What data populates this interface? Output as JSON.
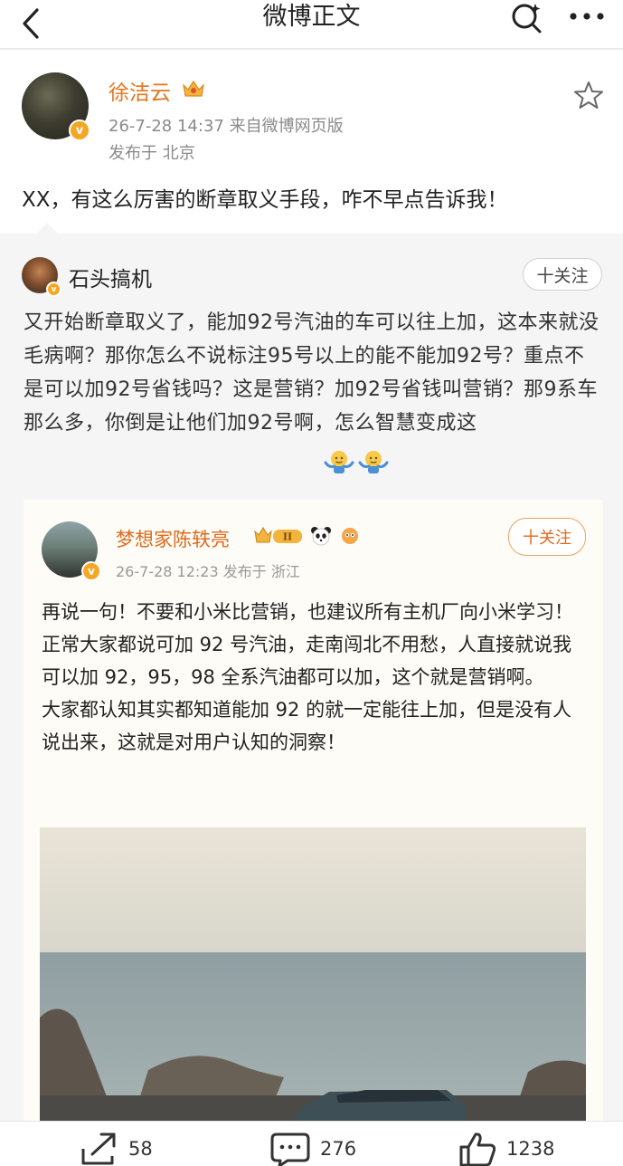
{
  "nav": {
    "title": "微博正文"
  },
  "post": {
    "author": "徐洁云",
    "time_source": "26-7-28 14:37  来自微博网页版",
    "location": "发布于 北京",
    "text": "XX，有这么厉害的断章取义手段，咋不早点告诉我！",
    "verified_badge": "v"
  },
  "repost": {
    "author": "石头搞机",
    "follow_label": "十关注",
    "text": "又开始断章取义了，能加92号汽油的车可以往上加，这本来就没毛病啊？那你怎么不说标注95号以上的能不能加92号？重点不是可以加92号省钱吗？这是营销？加92号省钱叫营销？那9系车那么多，你倒是让他们加92号啊，怎么智慧变成这",
    "verified_badge": "v",
    "emojis": [
      "shrug-emoji",
      "shrug-emoji"
    ]
  },
  "quoted": {
    "author": "梦想家陈轶亮",
    "level_badge": "II",
    "meta": "26-7-28 12:23  发布于 浙江",
    "follow_label": "十关注",
    "verified_badge": "v",
    "paragraphs": [
      "再说一句！不要和小米比营销，也建议所有主机厂向小米学习！",
      "正常大家都说可加 92 号汽油，走南闯北不用愁，人直接就说我可以加 92，95，98 全系汽油都可以加，这个就是营销啊。",
      "大家都认知其实都知道能加 92 的就一定能往上加，但是没有人说出来，这就是对用户认知的洞察！"
    ]
  },
  "toolbar": {
    "repost_count": "58",
    "comment_count": "276",
    "like_count": "1238"
  },
  "colors": {
    "author_orange": "#e3761f",
    "verified_orange": "#f5a623",
    "meta_gray": "#8a8a8a"
  }
}
